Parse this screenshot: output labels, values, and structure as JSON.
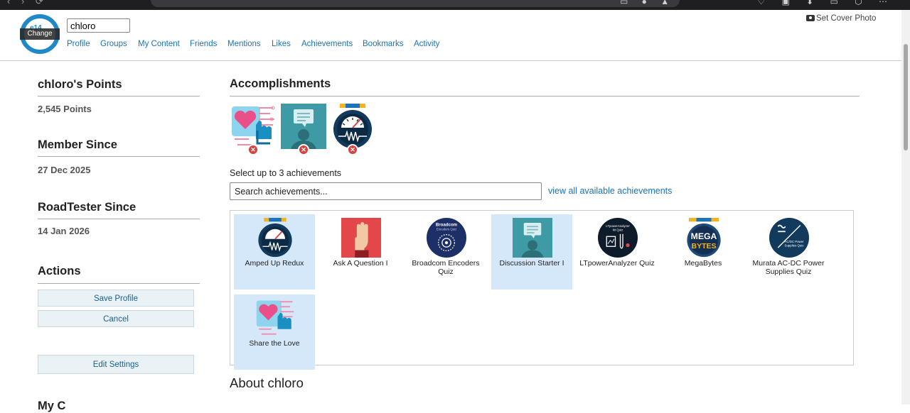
{
  "header": {
    "avatar_change": "Change",
    "avatar_text": "e14",
    "username": "chloro",
    "set_cover_photo": "Set Cover Photo",
    "nav": [
      "Profile",
      "Groups",
      "My Content",
      "Friends",
      "Mentions",
      "Likes",
      "Achievements",
      "Bookmarks",
      "Activity"
    ]
  },
  "sidebar": {
    "points_title": "chloro's Points",
    "points_value": "2,545 Points",
    "member_since_title": "Member Since",
    "member_since_value": "27 Dec 2025",
    "roadtester_title": "RoadTester Since",
    "roadtester_value": "14 Jan 2026",
    "actions_title": "Actions",
    "save_profile": "Save Profile",
    "cancel": "Cancel",
    "edit_settings": "Edit Settings",
    "next_section_partial": "My C"
  },
  "main": {
    "accomplishments_title": "Accomplishments",
    "remove_glyph": "✕",
    "select_label": "Select up to 3 achievements",
    "search_placeholder": "Search achievements...",
    "view_all": "view all available achievements",
    "achievements": [
      {
        "label": "Amped Up Redux",
        "icon": "meter-medal-icon",
        "selected": true
      },
      {
        "label": "Ask A Question I",
        "icon": "raised-hand-icon",
        "selected": false
      },
      {
        "label": "Broadcom Encoders Quiz",
        "icon": "broadcom-quiz-icon",
        "selected": false
      },
      {
        "label": "Discussion Starter I",
        "icon": "speech-bubble-person-icon",
        "selected": true
      },
      {
        "label": "LTpowerAnalyzer Quiz",
        "icon": "ltpoweranalyzer-quiz-icon",
        "selected": false
      },
      {
        "label": "MegaBytes",
        "icon": "megabytes-medal-icon",
        "selected": false
      },
      {
        "label": "Murata AC-DC Power Supplies Quiz",
        "icon": "murata-quiz-icon",
        "selected": false
      },
      {
        "label": "Share the Love",
        "icon": "heart-hand-icon",
        "selected": true
      }
    ],
    "badge_texts": {
      "broadcom_l1": "Broadcom",
      "broadcom_l2": "Encoders Quiz",
      "lt_l1": "LTpowerAnalyzer",
      "lt_l2": "kit Quiz",
      "mega_l1": "MEGA",
      "mega_l2": "BYTES",
      "murata_l1": "AC/DC Power",
      "murata_l2": "Supplies Quiz"
    },
    "about_title": "About chloro"
  },
  "colors": {
    "link": "#1a73b5",
    "selected_card": "#d5e8fa",
    "remove_badge": "#d9413d",
    "avatar_ring": "#1e88c8"
  }
}
